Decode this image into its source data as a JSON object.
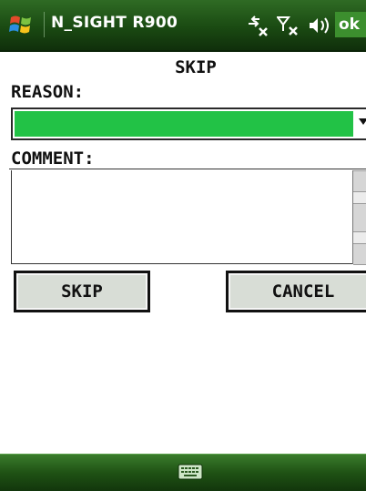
{
  "status_bar": {
    "app_title": "N_SIGHT R900",
    "ok_label": "ok",
    "icons": [
      "windows-start-icon",
      "connectivity-icon",
      "signal-off-icon",
      "volume-icon"
    ],
    "colors": {
      "bar": "#1a4a12",
      "ok": "#3c8f2e"
    }
  },
  "form": {
    "title": "SKIP",
    "reason_label": "REASON:",
    "reason_value": "",
    "comment_label": "COMMENT:",
    "comment_value": "",
    "skip_button": "SKIP",
    "cancel_button": "CANCEL",
    "colors": {
      "selected_reason": "#22c246"
    }
  },
  "bottom_bar": {
    "icons": [
      "keyboard-icon"
    ]
  }
}
